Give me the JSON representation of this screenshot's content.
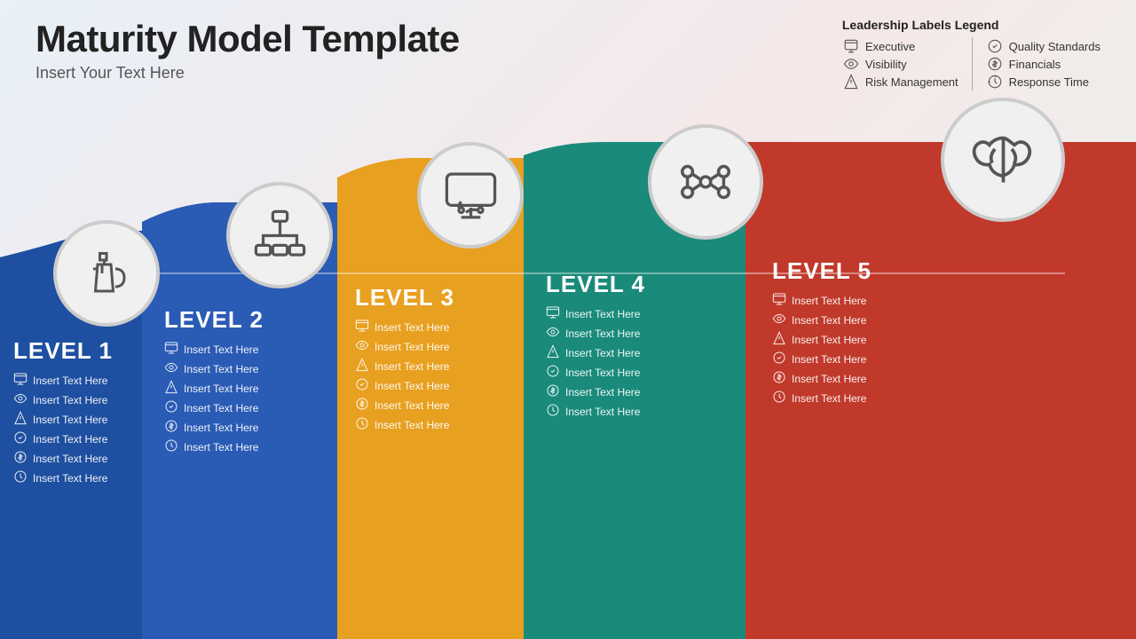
{
  "header": {
    "title": "Maturity Model Template",
    "subtitle": "Insert Your Text Here"
  },
  "legend": {
    "title": "Leadership Labels Legend",
    "items_left": [
      {
        "icon": "executive-icon",
        "label": "Executive"
      },
      {
        "icon": "visibility-icon",
        "label": "Visibility"
      },
      {
        "icon": "risk-icon",
        "label": "Risk Management"
      }
    ],
    "items_right": [
      {
        "icon": "quality-icon",
        "label": "Quality Standards"
      },
      {
        "icon": "financials-icon",
        "label": "Financials"
      },
      {
        "icon": "response-icon",
        "label": "Response Time"
      }
    ]
  },
  "levels": [
    {
      "id": "level-1",
      "title": "LEVEL 1",
      "items": [
        "Insert Text Here",
        "Insert Text Here",
        "Insert Text Here",
        "Insert Text Here",
        "Insert Text Here",
        "Insert Text Here"
      ]
    },
    {
      "id": "level-2",
      "title": "LEVEL 2",
      "items": [
        "Insert Text Here",
        "Insert Text Here",
        "Insert Text Here",
        "Insert Text Here",
        "Insert Text Here",
        "Insert Text Here"
      ]
    },
    {
      "id": "level-3",
      "title": "LEVEL 3",
      "items": [
        "Insert Text Here",
        "Insert Text Here",
        "Insert Text Here",
        "Insert Text Here",
        "Insert Text Here",
        "Insert Text Here"
      ]
    },
    {
      "id": "level-4",
      "title": "LEVEL 4",
      "items": [
        "Insert Text Here",
        "Insert Text Here",
        "Insert Text Here",
        "Insert Text Here",
        "Insert Text Here",
        "Insert Text Here"
      ]
    },
    {
      "id": "level-5",
      "title": "LEVEL 5",
      "items": [
        "Insert Text Here",
        "Insert Text Here",
        "Insert Text Here",
        "Insert Text Here",
        "Insert Text Here",
        "Insert Text Here"
      ]
    }
  ],
  "colors": {
    "level1": "#1e4fa0",
    "level2": "#2a5bb5",
    "level3": "#e8a020",
    "level4": "#1a8a7a",
    "level5": "#c0392b"
  }
}
